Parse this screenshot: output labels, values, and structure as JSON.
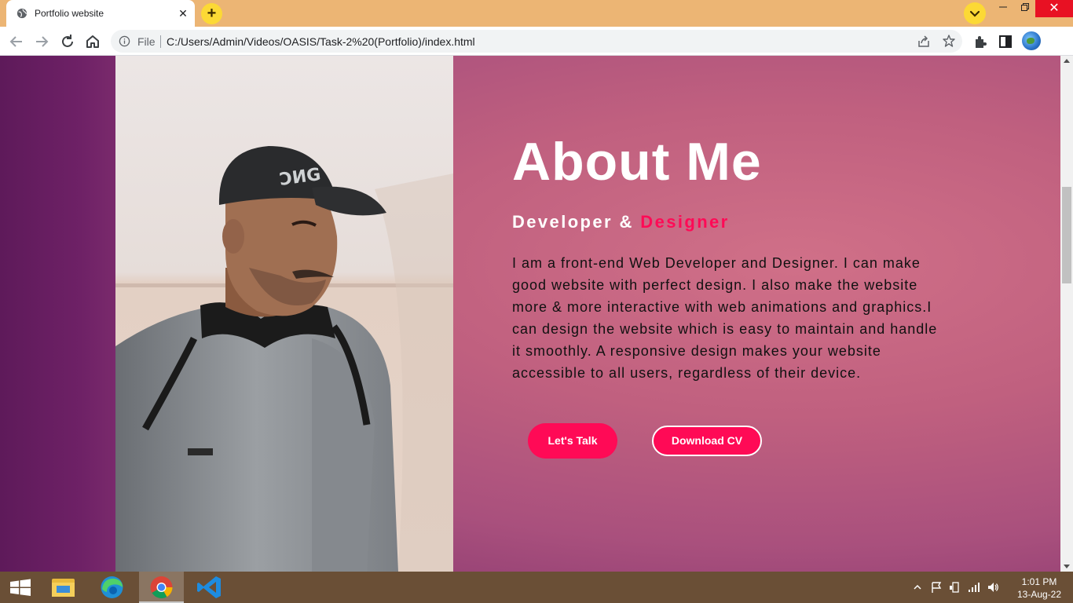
{
  "browser": {
    "tab_title": "Portfolio website",
    "address_prefix": "File",
    "url": "C:/Users/Admin/Videos/OASIS/Task-2%20(Portfolio)/index.html",
    "tab_bar_color": "#ecb574"
  },
  "page": {
    "heading": "About Me",
    "subtitle_main": "Developer & ",
    "subtitle_accent": "Designer",
    "body_text": "I am a front-end Web Developer and Designer. I can make good website with perfect design. I also make the website more & more interactive with web animations and graphics.I can design the website which is easy to maintain and handle it smoothly. A responsive design makes your website accessible to all users, regardless of their device.",
    "btn_talk": "Let's Talk",
    "btn_cv": "Download CV",
    "accent_color": "#ff0a56"
  },
  "taskbar": {
    "time": "1:01 PM",
    "date": "13-Aug-22",
    "apps": [
      "start",
      "file-explorer",
      "edge",
      "chrome",
      "vs-code"
    ],
    "active_app": "chrome"
  }
}
